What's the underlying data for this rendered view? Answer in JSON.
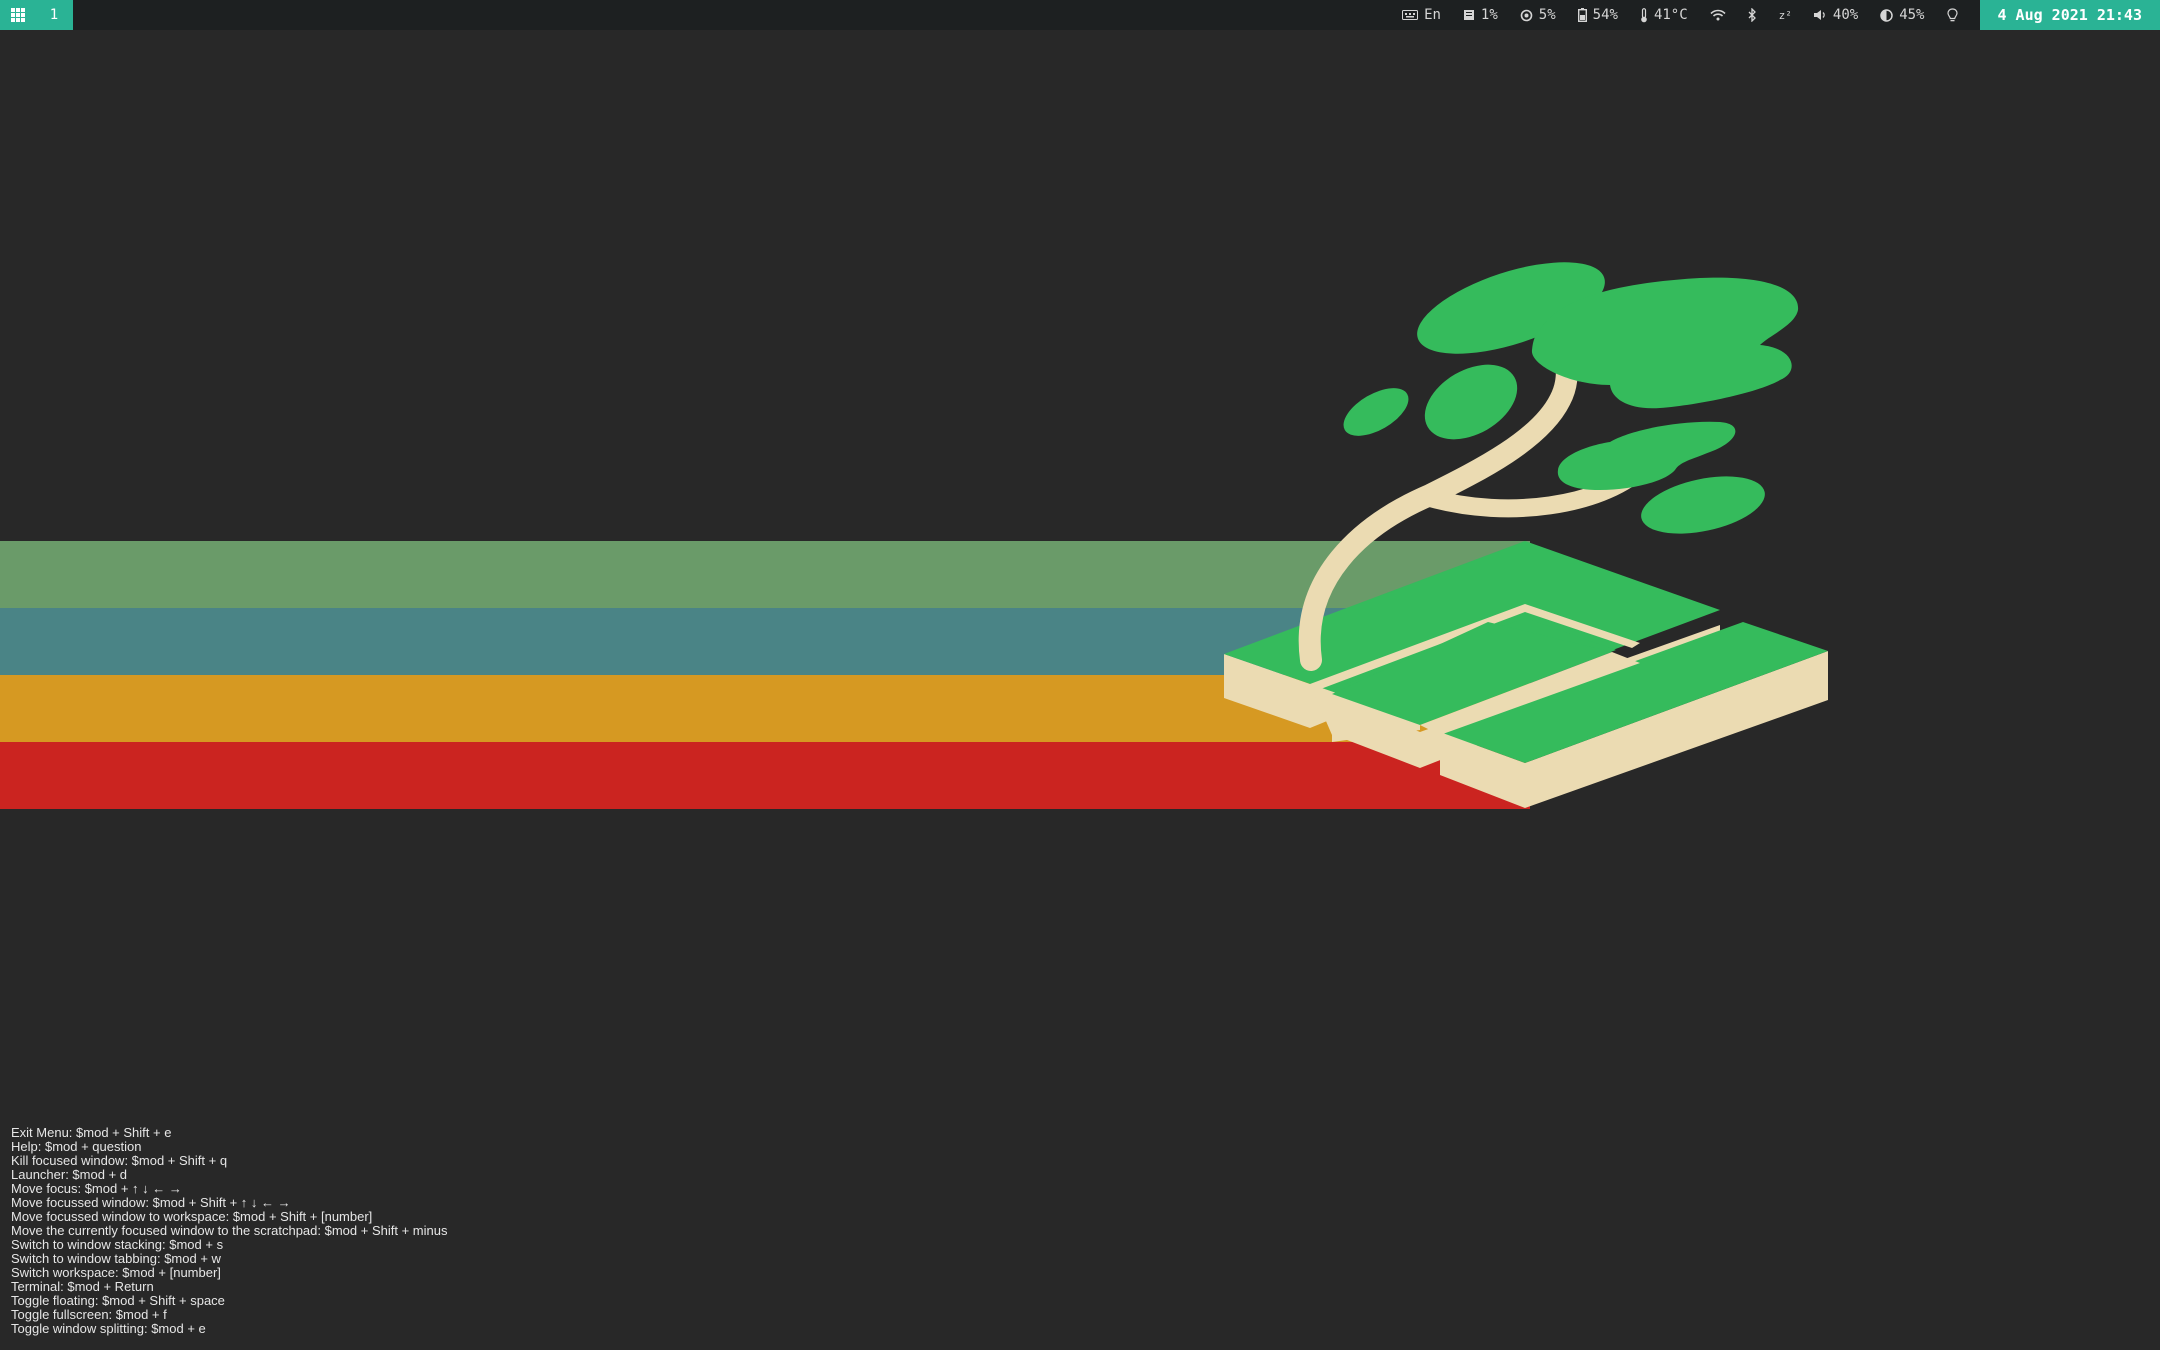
{
  "wallpaper": {
    "stripe_colors": [
      "#6a9b69",
      "#4a8486",
      "#d69922",
      "#cb2420"
    ],
    "leaf_color": "#35bb5c",
    "sand_color": "#ebdbb2"
  },
  "bar": {
    "workspace_menu_icon": "grid-icon",
    "workspace": "1",
    "accent": "#2ab395",
    "status": [
      {
        "icon": "keyboard-icon",
        "text": "En"
      },
      {
        "icon": "memory-icon",
        "text": "1%"
      },
      {
        "icon": "cpu-icon",
        "text": "5%"
      },
      {
        "icon": "battery-icon",
        "text": "54%"
      },
      {
        "icon": "thermometer-icon",
        "text": "41°C"
      },
      {
        "icon": "wifi-icon"
      },
      {
        "icon": "bluetooth-icon"
      },
      {
        "icon": "sleep-icon",
        "text": "z²"
      },
      {
        "icon": "volume-icon",
        "text": "40%"
      },
      {
        "icon": "brightness-icon",
        "text": "45%"
      },
      {
        "icon": "lightbulb-icon"
      }
    ],
    "clock": "4 Aug 2021 21:43"
  },
  "help": [
    "Exit Menu: $mod + Shift + e",
    "Help: $mod + question",
    "Kill focused window: $mod + Shift + q",
    "Launcher: $mod + d",
    "Move focus: $mod + ↑ ↓ ← →",
    "Move focussed window: $mod + Shift + ↑ ↓ ← →",
    "Move focussed window to workspace: $mod + Shift + [number]",
    "Move the currently focused window to the scratchpad: $mod + Shift + minus",
    "Switch to window stacking: $mod + s",
    "Switch to window tabbing: $mod + w",
    "Switch workspace: $mod + [number]",
    "Terminal: $mod + Return",
    "Toggle floating: $mod + Shift + space",
    "Toggle fullscreen: $mod + f",
    "Toggle window splitting: $mod + e"
  ]
}
